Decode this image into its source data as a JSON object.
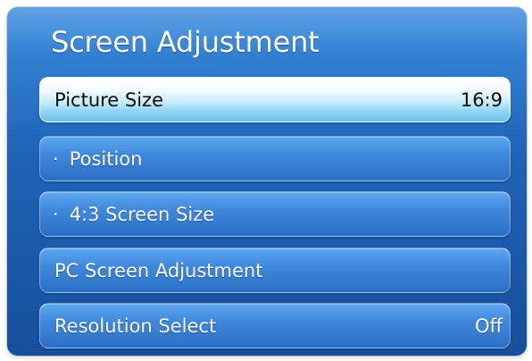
{
  "screen": {
    "title": "Screen Adjustment"
  },
  "menu": {
    "items": [
      {
        "label": "Picture Size",
        "value": "16:9",
        "selected": true,
        "sub": false
      },
      {
        "bullet": "·",
        "label": "Position",
        "value": "",
        "selected": false,
        "sub": true
      },
      {
        "bullet": "·",
        "label": "4:3 Screen Size",
        "value": "",
        "selected": false,
        "sub": true
      },
      {
        "label": "PC Screen Adjustment",
        "value": "",
        "selected": false,
        "sub": false
      },
      {
        "label": "Resolution Select",
        "value": "Off",
        "selected": false,
        "sub": false
      }
    ]
  },
  "colors": {
    "panel_top": "#3c8ee0",
    "panel_bottom": "#174f9b",
    "item_blue": "#3f89dc",
    "selected_highlight": "#c9ecfb",
    "text_light": "#ffffff",
    "text_dark": "#0a0a0a"
  }
}
